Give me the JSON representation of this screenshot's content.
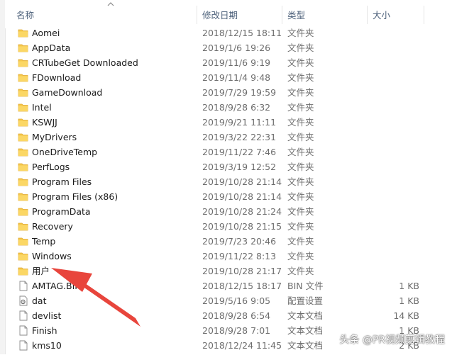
{
  "columns": {
    "name": "名称",
    "date": "修改日期",
    "type": "类型",
    "size": "大小"
  },
  "files": [
    {
      "icon": "folder-icon",
      "name": "Aomei",
      "date": "2018/12/15 18:11",
      "type": "文件夹",
      "size": ""
    },
    {
      "icon": "folder-icon",
      "name": "AppData",
      "date": "2019/1/6 19:26",
      "type": "文件夹",
      "size": ""
    },
    {
      "icon": "folder-icon",
      "name": "CRTubeGet Downloaded",
      "date": "2019/11/6 9:19",
      "type": "文件夹",
      "size": ""
    },
    {
      "icon": "folder-icon",
      "name": "FDownload",
      "date": "2019/11/4 9:48",
      "type": "文件夹",
      "size": ""
    },
    {
      "icon": "folder-icon",
      "name": "GameDownload",
      "date": "2019/7/29 19:59",
      "type": "文件夹",
      "size": ""
    },
    {
      "icon": "folder-icon",
      "name": "Intel",
      "date": "2018/9/28 6:32",
      "type": "文件夹",
      "size": ""
    },
    {
      "icon": "folder-icon",
      "name": "KSWJJ",
      "date": "2019/9/21 11:11",
      "type": "文件夹",
      "size": ""
    },
    {
      "icon": "folder-icon",
      "name": "MyDrivers",
      "date": "2019/3/22 22:31",
      "type": "文件夹",
      "size": ""
    },
    {
      "icon": "folder-icon",
      "name": "OneDriveTemp",
      "date": "2019/11/22 7:46",
      "type": "文件夹",
      "size": ""
    },
    {
      "icon": "folder-icon",
      "name": "PerfLogs",
      "date": "2019/3/19 12:52",
      "type": "文件夹",
      "size": ""
    },
    {
      "icon": "folder-icon",
      "name": "Program Files",
      "date": "2019/10/28 21:14",
      "type": "文件夹",
      "size": ""
    },
    {
      "icon": "folder-icon",
      "name": "Program Files (x86)",
      "date": "2019/10/28 21:14",
      "type": "文件夹",
      "size": ""
    },
    {
      "icon": "folder-icon",
      "name": "ProgramData",
      "date": "2019/10/28 21:24",
      "type": "文件夹",
      "size": ""
    },
    {
      "icon": "folder-icon",
      "name": "Recovery",
      "date": "2019/10/28 21:15",
      "type": "文件夹",
      "size": ""
    },
    {
      "icon": "folder-icon",
      "name": "Temp",
      "date": "2019/7/23 20:46",
      "type": "文件夹",
      "size": ""
    },
    {
      "icon": "folder-icon",
      "name": "Windows",
      "date": "2019/11/22 8:13",
      "type": "文件夹",
      "size": ""
    },
    {
      "icon": "folder-icon",
      "name": "用户",
      "date": "2019/10/28 21:17",
      "type": "文件夹",
      "size": ""
    },
    {
      "icon": "file-icon",
      "name": "AMTAG.BIN",
      "date": "2018/12/15 18:17",
      "type": "BIN 文件",
      "size": "1 KB"
    },
    {
      "icon": "config-file-icon",
      "name": "dat",
      "date": "2019/5/16 9:05",
      "type": "配置设置",
      "size": "1 KB"
    },
    {
      "icon": "file-icon",
      "name": "devlist",
      "date": "2018/9/28 6:54",
      "type": "文本文档",
      "size": "14 KB"
    },
    {
      "icon": "file-icon",
      "name": "Finish",
      "date": "2018/9/28 7:01",
      "type": "文本文档",
      "size": "1 KB"
    },
    {
      "icon": "file-icon",
      "name": "kms10",
      "date": "2018/12/24 11:45",
      "type": "文本文档",
      "size": "2 KB"
    }
  ],
  "watermark": "头条 @PR视频剪辑教程",
  "colors": {
    "folder": "#f5c84c",
    "folder_dark": "#e0a82e",
    "arrow": "#e8453c",
    "header_text": "#4c607a"
  }
}
